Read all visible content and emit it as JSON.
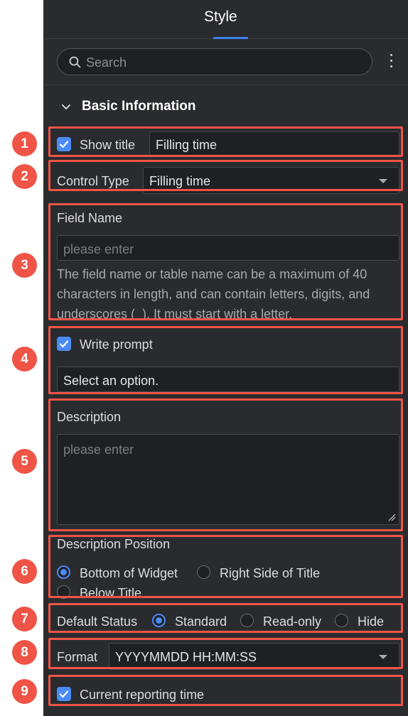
{
  "header": {
    "tab_label": "Style"
  },
  "search": {
    "placeholder": "Search"
  },
  "section": {
    "title": "Basic Information"
  },
  "show_title": {
    "label": "Show title",
    "checked": true,
    "value": "Filling time"
  },
  "control_type": {
    "label": "Control Type",
    "value": "Filling time"
  },
  "field_name": {
    "label": "Field Name",
    "placeholder": "please enter",
    "help": "The field name or table name can be a maximum of 40 characters in length, and can contain letters, digits, and underscores (_). It must start with a letter."
  },
  "write_prompt": {
    "label": "Write prompt",
    "checked": true,
    "select_value": "Select an option."
  },
  "description": {
    "label": "Description",
    "placeholder": "please enter"
  },
  "description_position": {
    "label": "Description Position",
    "options": [
      "Bottom of Widget",
      "Right Side of Title",
      "Below Title"
    ],
    "selected": "Bottom of Widget"
  },
  "default_status": {
    "label": "Default Status",
    "options": [
      "Standard",
      "Read-only",
      "Hide"
    ],
    "selected": "Standard"
  },
  "format": {
    "label": "Format",
    "value": "YYYYMMDD HH:MM:SS"
  },
  "current_reporting_time": {
    "label": "Current reporting time",
    "checked": true
  },
  "annotations": [
    "1",
    "2",
    "3",
    "4",
    "5",
    "6",
    "7",
    "8",
    "9"
  ],
  "colors": {
    "accent": "#4a8bf5",
    "annotation": "#ef5446",
    "panel_bg": "#2a2b2e",
    "tab_indicator": "#3d7ff0"
  }
}
